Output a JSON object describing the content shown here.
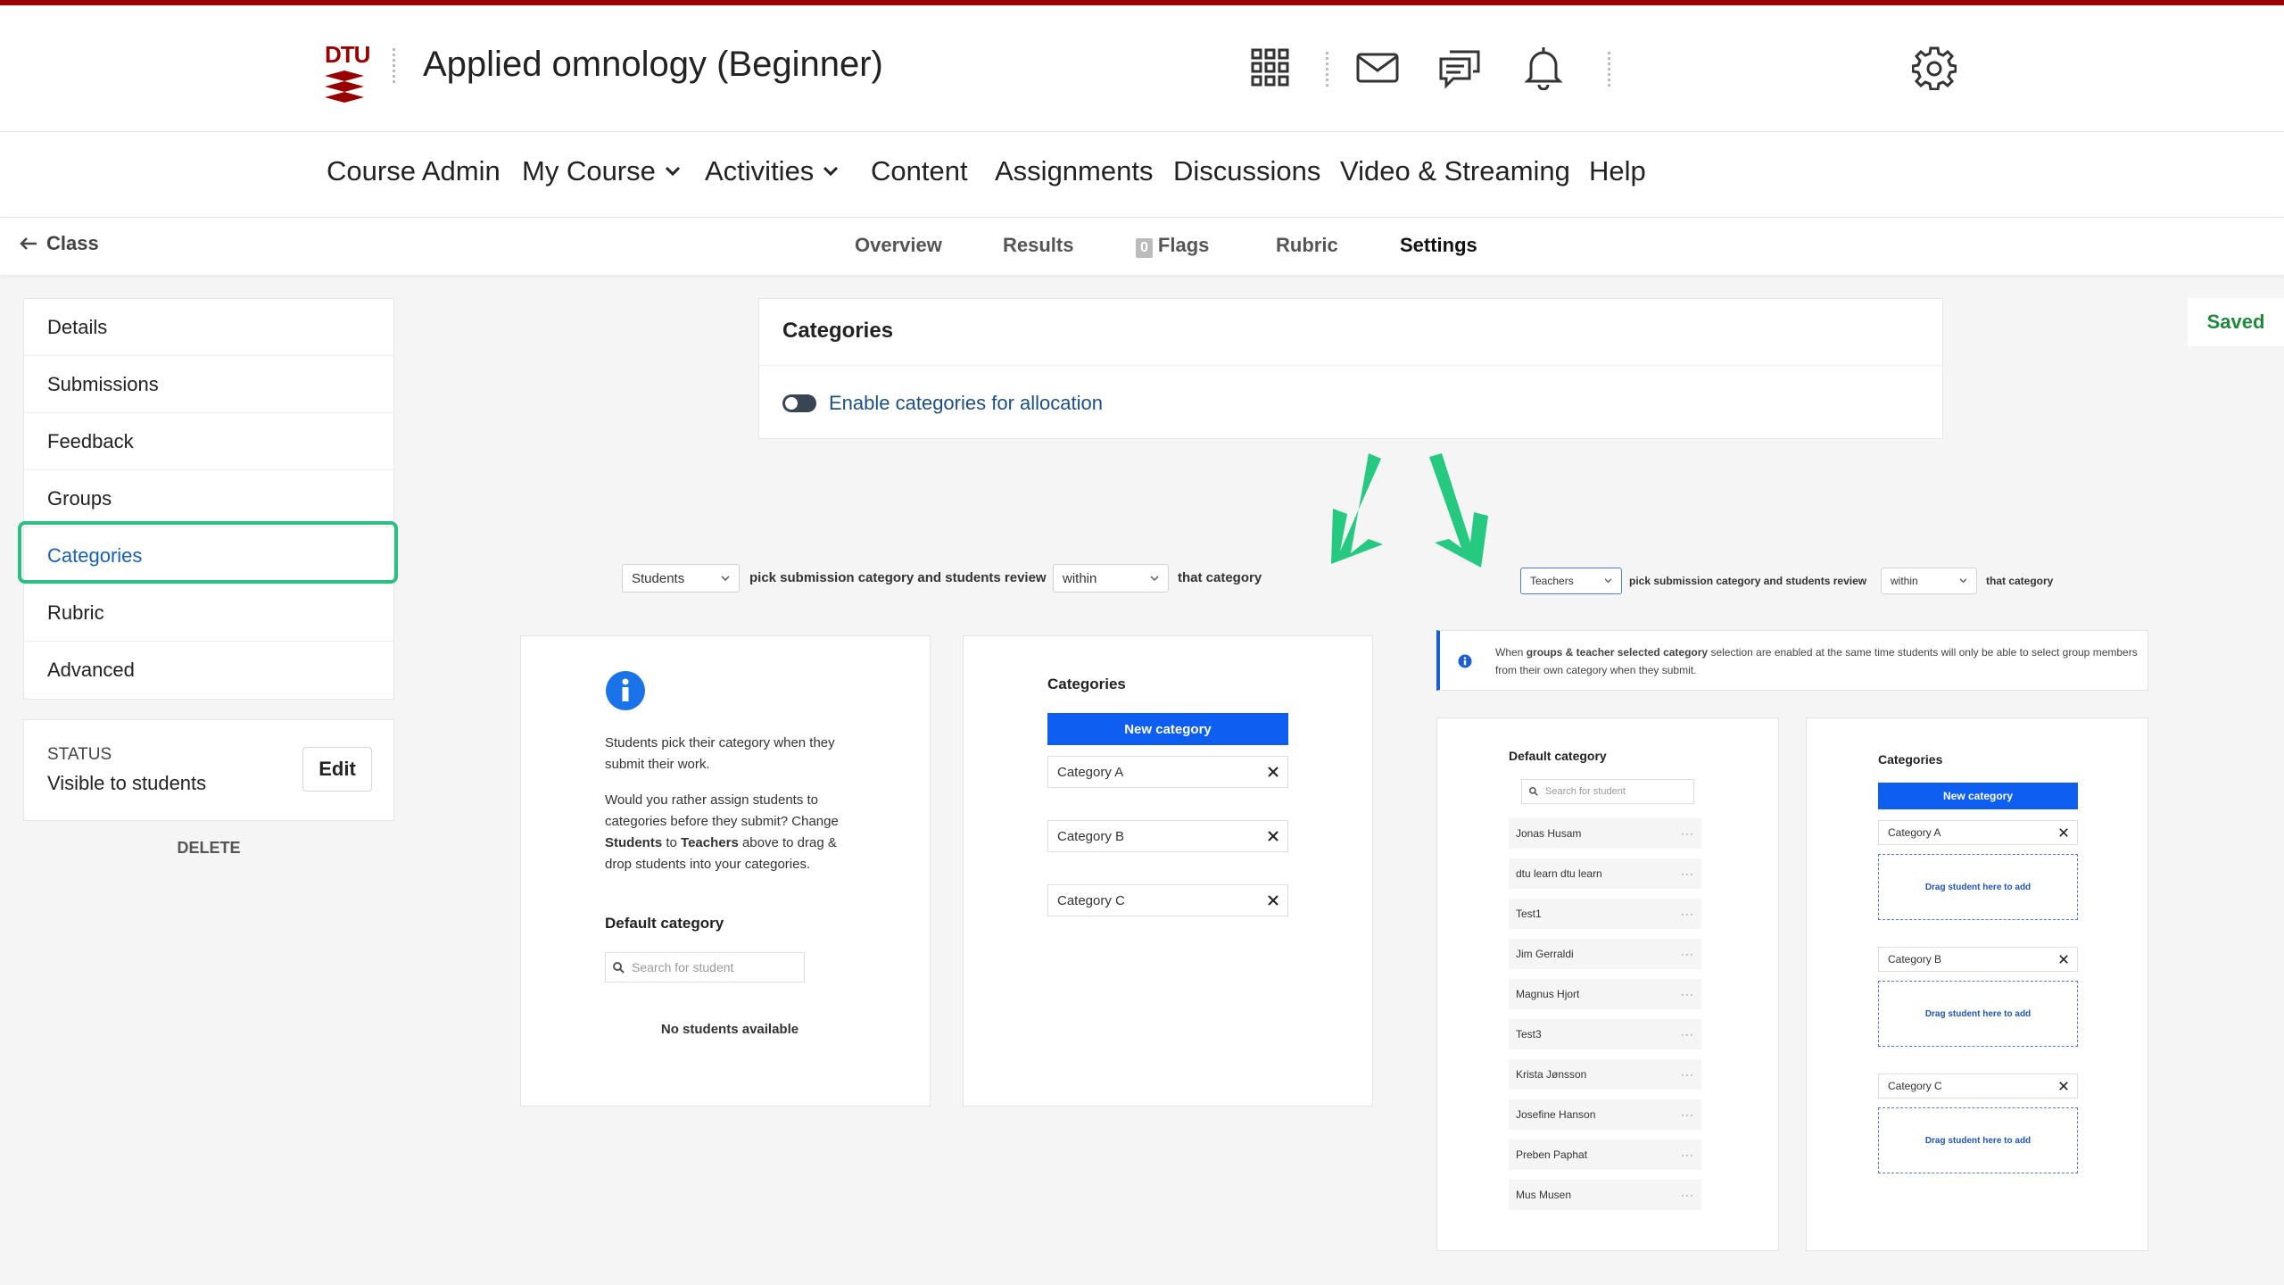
{
  "header": {
    "logo_text": "DTU",
    "title": "Applied omnology (Beginner)",
    "icons": [
      "apps-grid-icon",
      "mail-icon",
      "chat-icon",
      "bell-icon",
      "gear-icon"
    ]
  },
  "nav": {
    "items": [
      {
        "label": "Course Admin"
      },
      {
        "label": "My Course"
      },
      {
        "label": "Activities"
      },
      {
        "label": "Content"
      },
      {
        "label": "Assignments"
      },
      {
        "label": "Discussions"
      },
      {
        "label": "Video & Streaming"
      },
      {
        "label": "Help"
      }
    ]
  },
  "subnav": {
    "back_label": "Class",
    "tabs": [
      "Overview",
      "Results",
      "Flags",
      "Rubric",
      "Settings"
    ],
    "flags_count": "0",
    "active_tab": "Settings"
  },
  "sidebar": {
    "items": [
      "Details",
      "Submissions",
      "Feedback",
      "Groups",
      "Categories",
      "Rubric",
      "Advanced"
    ],
    "active": "Categories",
    "status_label": "STATUS",
    "status_value": "Visible to students",
    "edit_label": "Edit",
    "delete_label": "DELETE"
  },
  "categories_card": {
    "title": "Categories",
    "toggle_label": "Enable categories for allocation"
  },
  "saved_label": "Saved",
  "left_example": {
    "who_select": "Students",
    "middle_text": "pick submission category and students review",
    "scope_select": "within",
    "end_text": "that category",
    "info_p1": "Students pick their category when they submit their work.",
    "info_p2_a": "Would you rather assign students to categories before they submit? Change ",
    "info_p2_b": "Students",
    "info_p2_c": " to ",
    "info_p2_d": "Teachers",
    "info_p2_e": " above to drag & drop students into your categories.",
    "default_category": "Default category",
    "search_placeholder": "Search for student",
    "no_students": "No students available",
    "categories_title": "Categories",
    "new_category": "New category",
    "categories": [
      "Category A",
      "Category B",
      "Category C"
    ]
  },
  "right_example": {
    "who_select": "Teachers",
    "middle_text": "pick submission category and students review",
    "scope_select": "within",
    "end_text": "that category",
    "notice_a": "When ",
    "notice_b": "groups & teacher selected category",
    "notice_c": " selection are enabled at the same time students will only be able to select group members from their own category when they submit.",
    "default_category": "Default category",
    "search_placeholder": "Search for student",
    "students": [
      "Jonas Husam",
      "dtu learn dtu learn",
      "Test1",
      "Jim Gerraldi",
      "Magnus Hjort",
      "Test3",
      "Krista Jønsson",
      "Josefine Hanson",
      "Preben Paphat",
      "Mus Musen"
    ],
    "categories_title": "Categories",
    "new_category": "New category",
    "categories": [
      "Category A",
      "Category B",
      "Category C"
    ],
    "drop_text": "Drag student here to add"
  },
  "colors": {
    "brand": "#990000",
    "accent_blue": "#0f5ef2",
    "highlight_green": "#2bbf84",
    "saved_green": "#1f8a3b"
  }
}
